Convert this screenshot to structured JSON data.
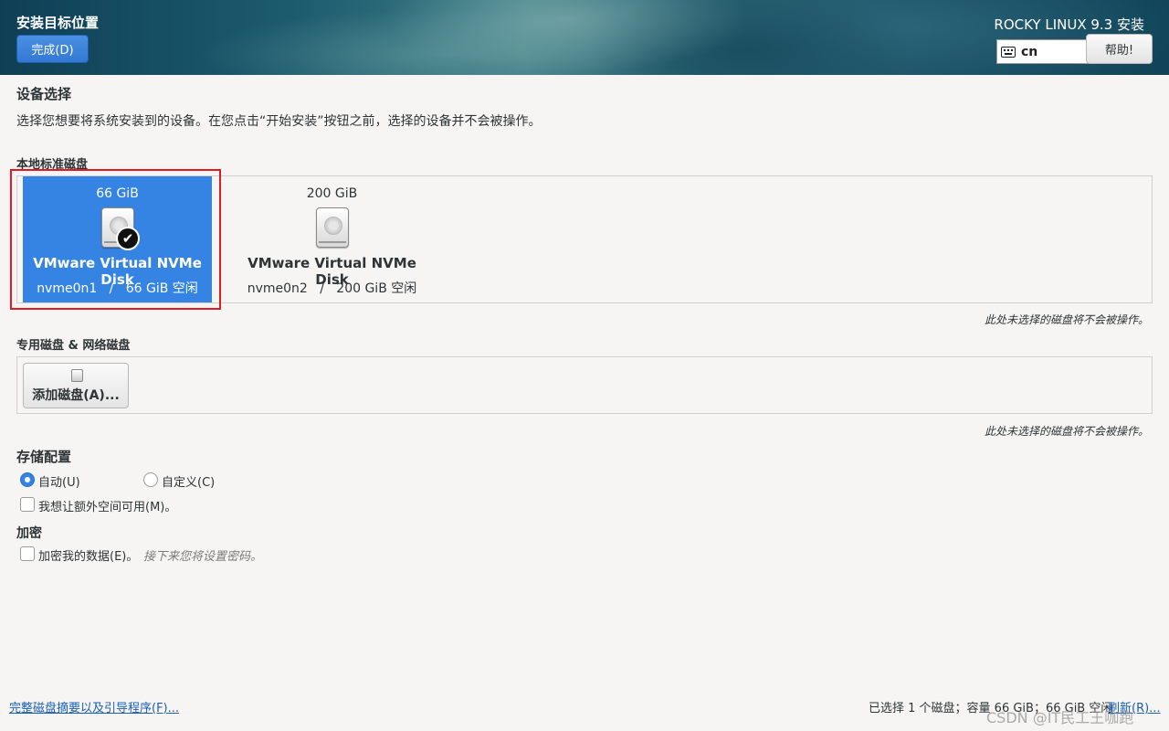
{
  "header": {
    "title": "安装目标位置",
    "done_label": "完成(D)",
    "product": "ROCKY LINUX 9.3 安装",
    "keyboard_layout": "cn",
    "help_label": "帮助!"
  },
  "device_selection": {
    "title": "设备选择",
    "description": "选择您想要将系统安装到的设备。在您点击“开始安装”按钮之前，选择的设备并不会被操作。"
  },
  "local_disks": {
    "heading": "本地标准磁盘",
    "disks": [
      {
        "size": "66 GiB",
        "name": "VMware Virtual NVMe Disk",
        "device": "nvme0n1",
        "free": "66 GiB 空闲",
        "selected": true
      },
      {
        "size": "200 GiB",
        "name": "VMware Virtual NVMe Disk",
        "device": "nvme0n2",
        "free": "200 GiB 空闲",
        "selected": false
      }
    ],
    "note": "此处未选择的磁盘将不会被操作。"
  },
  "special_disks": {
    "heading": "专用磁盘 & 网络磁盘",
    "add_label": "添加磁盘(A)...",
    "note": "此处未选择的磁盘将不会被操作。"
  },
  "storage_config": {
    "title": "存储配置",
    "auto_label": "自动(U)",
    "custom_label": "自定义(C)",
    "selected": "auto",
    "extra_space_label": "我想让额外空间可用(M)。"
  },
  "encryption": {
    "title": "加密",
    "encrypt_label": "加密我的数据(E)。",
    "hint": "接下来您将设置密码。"
  },
  "footer": {
    "summary_link": "完整磁盘摘要以及引导程序(F)...",
    "status": "已选择 1 个磁盘；容量 66 GiB；66 GiB 空闲",
    "refresh": "刷新(R)..."
  },
  "watermark": "CSDN @IT民工王咖跑",
  "colors": {
    "accent": "#3584e4",
    "highlight": "#e01b24",
    "link": "#1a5fb4"
  }
}
